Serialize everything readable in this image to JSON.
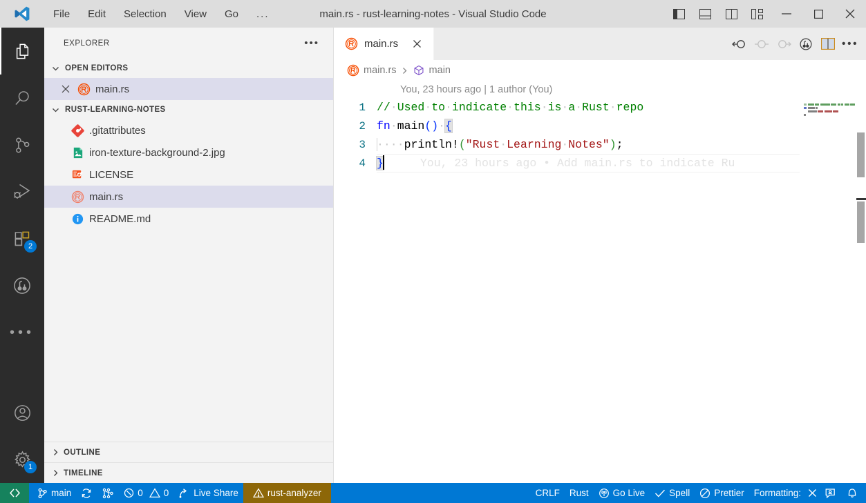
{
  "window": {
    "title": "main.rs - rust-learning-notes - Visual Studio Code",
    "menu": [
      "File",
      "Edit",
      "Selection",
      "View",
      "Go",
      "..."
    ],
    "layout_controls": [
      "toggle-primary-sidebar",
      "toggle-panel",
      "toggle-secondary-sidebar",
      "customize-layout"
    ],
    "controls": {
      "minimize": "─",
      "maximize": "□",
      "close": "✕"
    }
  },
  "activitybar": {
    "items": [
      {
        "name": "explorer",
        "icon": "files-icon",
        "active": true,
        "badge": ""
      },
      {
        "name": "search",
        "icon": "search-icon",
        "active": false,
        "badge": ""
      },
      {
        "name": "source-control",
        "icon": "source-control-icon",
        "active": false,
        "badge": ""
      },
      {
        "name": "run-and-debug",
        "icon": "run-debug-icon",
        "active": false,
        "badge": ""
      },
      {
        "name": "extensions",
        "icon": "extensions-icon",
        "active": false,
        "badge": "2"
      },
      {
        "name": "github-pull-requests",
        "icon": "git-pull-request-icon",
        "active": false,
        "badge": ""
      },
      {
        "name": "additional-views",
        "icon": "ellipsis-icon",
        "active": false,
        "badge": ""
      }
    ],
    "bottom": [
      {
        "name": "accounts",
        "icon": "account-icon",
        "badge": ""
      },
      {
        "name": "manage",
        "icon": "gear-icon",
        "badge": "1"
      }
    ]
  },
  "sidebar": {
    "title": "EXPLORER",
    "more_actions": "•••",
    "open_editors": {
      "label": "OPEN EDITORS",
      "expanded": true,
      "items": [
        {
          "name": "main.rs",
          "icon": "rust-file-icon",
          "selected": true,
          "close": "✕"
        }
      ]
    },
    "folder": {
      "label": "RUST-LEARNING-NOTES",
      "expanded": true,
      "files": [
        {
          "name": ".gitattributes",
          "icon": "git-file-icon",
          "selected": false
        },
        {
          "name": "iron-texture-background-2.jpg",
          "icon": "image-file-icon",
          "selected": false
        },
        {
          "name": "LICENSE",
          "icon": "license-file-icon",
          "selected": false
        },
        {
          "name": "main.rs",
          "icon": "rust-file-icon",
          "selected": true
        },
        {
          "name": "README.md",
          "icon": "info-file-icon",
          "selected": false
        }
      ]
    },
    "collapsed_sections": [
      {
        "label": "OUTLINE"
      },
      {
        "label": "TIMELINE"
      }
    ]
  },
  "editor": {
    "tabs": [
      {
        "label": "main.rs",
        "icon": "rust-file-icon",
        "active": true,
        "close": "✕"
      }
    ],
    "actions": [
      {
        "name": "go-to-previous-change",
        "icon": "arrow-circle-left-icon"
      },
      {
        "name": "current-change",
        "icon": "circle-icon"
      },
      {
        "name": "go-to-next-change",
        "icon": "arrow-circle-right-icon"
      },
      {
        "name": "open-changes",
        "icon": "git-compare-icon"
      },
      {
        "name": "split-editor-right",
        "icon": "split-editor-icon"
      },
      {
        "name": "more-actions",
        "icon": "ellipsis-icon"
      }
    ],
    "breadcrumb": [
      {
        "label": "main.rs",
        "icon": "rust-file-icon"
      },
      {
        "label": "main",
        "icon": "symbol-method-icon"
      }
    ],
    "blame_header": "You, 23 hours ago | 1 author (You)",
    "inline_blame": "You, 23 hours ago • Add main.rs to indicate Ru",
    "lines": [
      {
        "number": "1",
        "text": "// Used to indicate this is a Rust repo"
      },
      {
        "number": "2",
        "text": "fn main() {"
      },
      {
        "number": "3",
        "text": "    println!(\"Rust Learning Notes\");"
      },
      {
        "number": "4",
        "text": "}"
      }
    ],
    "code_tokens": {
      "comment": "// Used to indicate this is a Rust repo",
      "kw_fn": "fn",
      "fn_name": "main",
      "parens": "()",
      "open_brace": "{",
      "macro_name": "println!",
      "string": "\"Rust Learning Notes\"",
      "semicolon": ";",
      "close_brace": "}"
    }
  },
  "statusbar": {
    "remote_icon": "remote-window-icon",
    "left": [
      {
        "name": "branch",
        "icon": "git-branch-icon",
        "label": "main"
      },
      {
        "name": "sync-changes",
        "icon": "sync-icon",
        "label": ""
      },
      {
        "name": "git-graph",
        "icon": "git-graph-icon",
        "label": ""
      },
      {
        "name": "problems",
        "icon": "error-warning-icon",
        "label": "0  0",
        "errors": "0",
        "warnings": "0"
      },
      {
        "name": "live-share",
        "icon": "live-share-icon",
        "label": "Live Share"
      },
      {
        "name": "rust-analyzer",
        "icon": "warning-icon",
        "label": "rust-analyzer",
        "warning": true
      }
    ],
    "right": [
      {
        "name": "eol",
        "icon": "",
        "label": "CRLF"
      },
      {
        "name": "language-mode",
        "icon": "",
        "label": "Rust"
      },
      {
        "name": "go-live",
        "icon": "broadcast-icon",
        "label": "Go Live"
      },
      {
        "name": "spell-checker",
        "icon": "check-icon",
        "label": "Spell"
      },
      {
        "name": "prettier",
        "icon": "circle-slash-icon",
        "label": "Prettier"
      },
      {
        "name": "formatting",
        "icon": "",
        "label": "Formatting:"
      },
      {
        "name": "formatting-cancel",
        "icon": "close-icon",
        "label": "✕"
      },
      {
        "name": "feedback",
        "icon": "feedback-icon",
        "label": ""
      },
      {
        "name": "notifications",
        "icon": "bell-icon",
        "label": ""
      }
    ]
  },
  "colors": {
    "accent": "#0078d4",
    "titlebar_bg": "#dddddd",
    "sidebar_bg": "#f3f3f3",
    "activitybar_bg": "#2c2c2c",
    "selection_bg": "#dcdcec",
    "warn_bg": "#8d6708",
    "remote_bg": "#16825d",
    "rust_icon": "#f74c00",
    "comment": "#008000",
    "keyword": "#0000ff",
    "string": "#a31515",
    "linenumber": "#0b7285"
  }
}
